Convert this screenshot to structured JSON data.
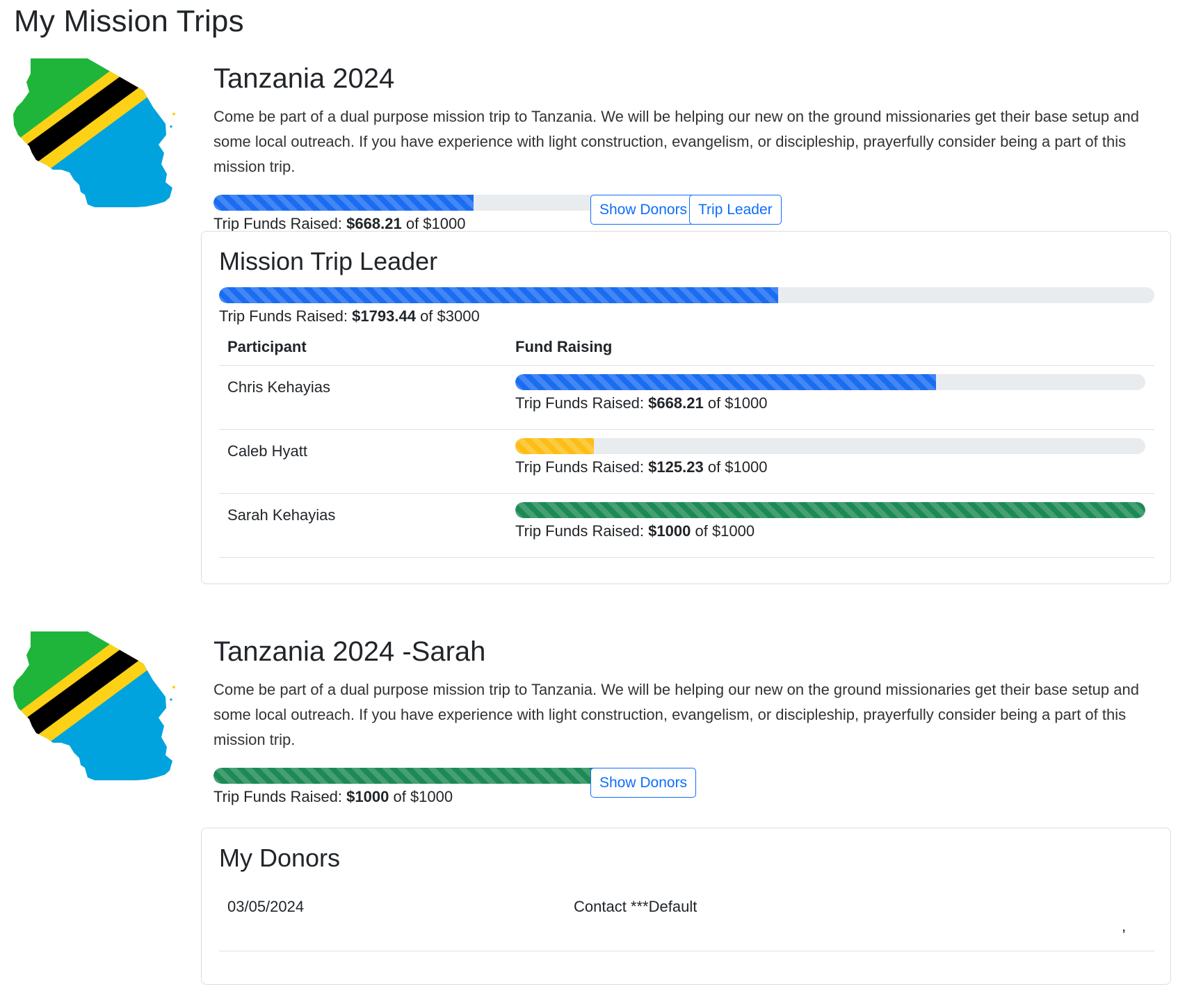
{
  "page": {
    "title": "My Mission Trips"
  },
  "trips": [
    {
      "title": "Tanzania 2024",
      "description": "Come be part of a dual purpose mission trip to Tanzania. We will be helping our new on the ground missionaries get their base setup and some local outreach. If you have experience with light construction, evangelism, or discipleship, prayerfully consider being a part of this mission trip.",
      "funds": {
        "label": "Trip Funds Raised:",
        "raised": "$668.21",
        "of": "of $1000",
        "fraction": 0.668,
        "color": "#1a6cf2"
      },
      "buttons": {
        "show_donors": "Show Donors",
        "trip_leader": "Trip Leader"
      },
      "leader_card": {
        "title": "Mission Trip Leader",
        "funds": {
          "label": "Trip Funds Raised:",
          "raised": "$1793.44",
          "of": "of $3000",
          "fraction": 0.598,
          "color": "#1a6cf2"
        },
        "table": {
          "headers": {
            "participant": "Participant",
            "fund_raising": "Fund Raising"
          },
          "rows": [
            {
              "name": "Chris Kehayias",
              "label": "Trip Funds Raised:",
              "raised": "$668.21",
              "of": "of $1000",
              "fraction": 0.668,
              "color": "#1a6cf2"
            },
            {
              "name": "Caleb Hyatt",
              "label": "Trip Funds Raised:",
              "raised": "$125.23",
              "of": "of $1000",
              "fraction": 0.125,
              "color": "#fdbd14"
            },
            {
              "name": "Sarah Kehayias",
              "label": "Trip Funds Raised:",
              "raised": "$1000",
              "of": "of $1000",
              "fraction": 1.0,
              "color": "#1d8a55"
            }
          ]
        }
      }
    },
    {
      "title": "Tanzania 2024 -Sarah",
      "description": "Come be part of a dual purpose mission trip to Tanzania. We will be helping our new on the ground missionaries get their base setup and some local outreach. If you have experience with light construction, evangelism, or discipleship, prayerfully consider being a part of this mission trip.",
      "funds": {
        "label": "Trip Funds Raised:",
        "raised": "$1000",
        "of": "of $1000",
        "fraction": 1.0,
        "color": "#1d8a55"
      },
      "buttons": {
        "show_donors": "Show Donors"
      },
      "donors_card": {
        "title": "My Donors",
        "donors": [
          {
            "date": "03/05/2024",
            "name": "Contact ***Default",
            "extra": ","
          }
        ]
      }
    }
  ],
  "icons": {
    "map": "tanzania-flag-map-icon"
  },
  "colors": {
    "primary": "#0d6efd",
    "flag_green": "#1eb53a",
    "flag_yellow": "#fcd116",
    "flag_blue": "#00a3dd",
    "flag_black": "#000000"
  }
}
